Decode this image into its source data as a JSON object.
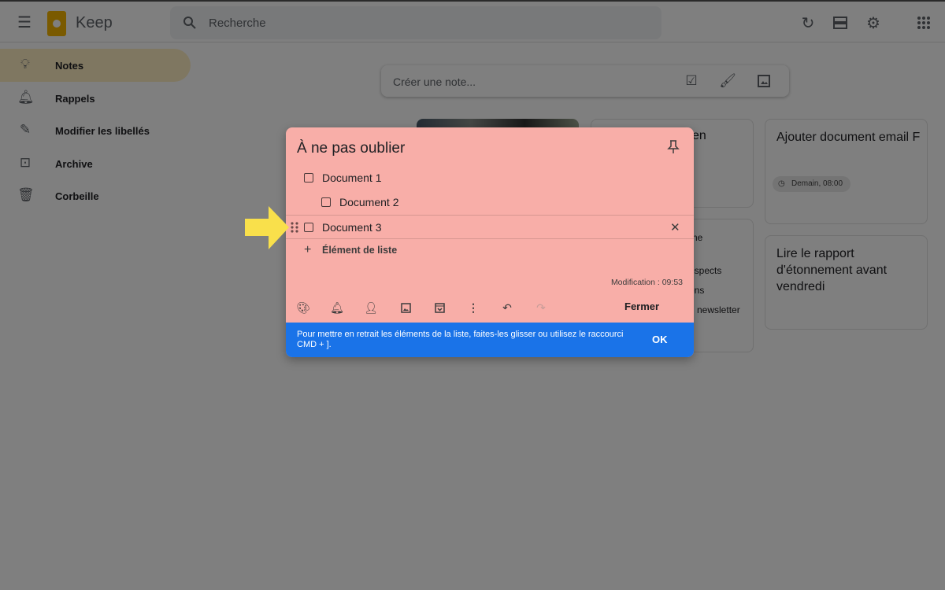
{
  "header": {
    "app_name": "Keep",
    "search_placeholder": "Recherche",
    "icons": [
      "menu-icon",
      "refresh-icon",
      "list-view-icon",
      "settings-icon",
      "apps-icon"
    ]
  },
  "sidebar": {
    "items": [
      {
        "label": "Notes",
        "icon": "lightbulb-icon",
        "active": true
      },
      {
        "label": "Rappels",
        "icon": "bell-icon"
      },
      {
        "label": "Modifier les libellés",
        "icon": "pencil-icon"
      },
      {
        "label": "Archive",
        "icon": "archive-icon"
      },
      {
        "label": "Corbeille",
        "icon": "trash-icon"
      }
    ]
  },
  "create_note": {
    "placeholder": "Créer une note..."
  },
  "cards": [
    {
      "fragment": "en"
    },
    {
      "title": "Ajouter document email F",
      "reminder": "Demain, 08:00"
    },
    {
      "fragments": [
        "ne",
        "ospects",
        "ons",
        "newsletter"
      ]
    },
    {
      "title": "Lire le rapport d'étonnement avant vendredi"
    }
  ],
  "dialog": {
    "title": "À ne pas oublier",
    "items": [
      {
        "text": "Document 1",
        "indent": false,
        "checked": false
      },
      {
        "text": "Document 2",
        "indent": true,
        "checked": false
      },
      {
        "text": "Document 3",
        "indent": false,
        "checked": false
      }
    ],
    "add_item": "Élément de liste",
    "modified": "Modification : 09:53",
    "close_label": "Fermer",
    "background_color": "#f8aea8",
    "banner": {
      "text": "Pour mettre en retrait les éléments de la liste, faites-les glisser ou utilisez le raccourci CMD + ].",
      "ok": "OK",
      "color": "#1a73e8"
    }
  },
  "annotation_arrow_color": "#f9e04b"
}
